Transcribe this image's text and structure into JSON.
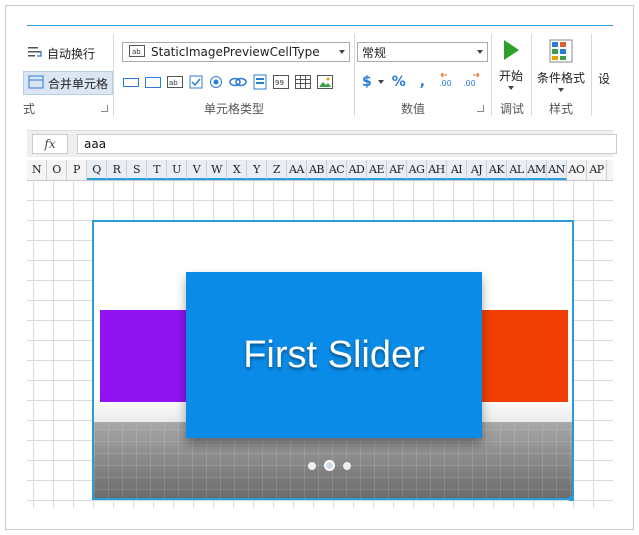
{
  "ribbon": {
    "wrap_text_label": "自动换行",
    "merge_cells_label": "合并单元格",
    "alignment_group_fragment": "式",
    "cell_type_value": "StaticImagePreviewCellType",
    "cell_type_group_label": "单元格类型",
    "number_format_value": "常规",
    "number_group_label": "数值",
    "currency_symbol": "$",
    "percent_symbol": "%",
    "comma_symbol": ",",
    "start_label": "开始",
    "debug_group_label": "调试",
    "conditional_format_label": "条件格式",
    "style_group_label": "样式",
    "settings_fragment": "设"
  },
  "formula_bar": {
    "fx_label": "fx",
    "value": "aaa"
  },
  "columns": [
    "N",
    "O",
    "P",
    "Q",
    "R",
    "S",
    "T",
    "U",
    "V",
    "W",
    "X",
    "Y",
    "Z",
    "AA",
    "AB",
    "AC",
    "AD",
    "AE",
    "AF",
    "AG",
    "AH",
    "AI",
    "AJ",
    "AK",
    "AL",
    "AM",
    "AN",
    "AO",
    "AP"
  ],
  "slider": {
    "title": "First Slider",
    "left_color": "#9013f2",
    "main_color": "#0a8be8",
    "right_color": "#f23f03",
    "dot_count": 3,
    "active_dot": 2
  },
  "colors": {
    "accent": "#26a0da",
    "play_green": "#2ba02b"
  }
}
